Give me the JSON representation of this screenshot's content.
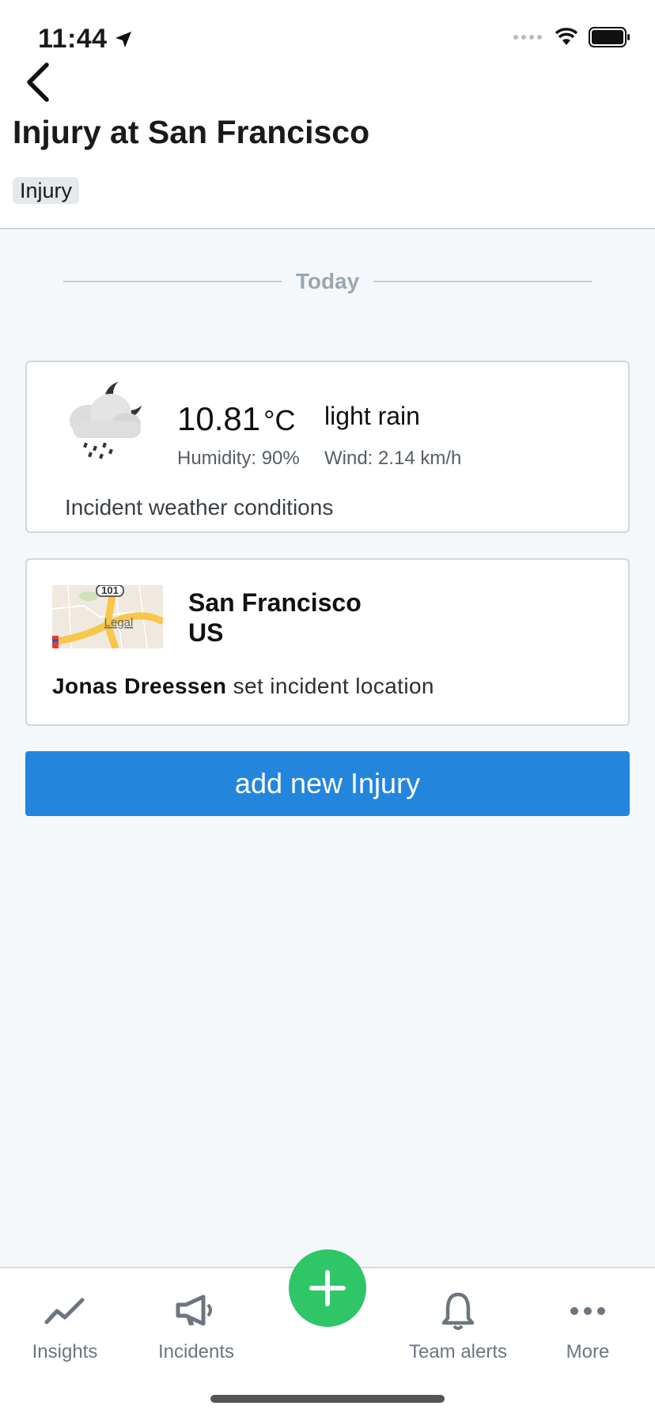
{
  "status_bar": {
    "time": "11:44"
  },
  "header": {
    "title": "Injury at San Francisco",
    "tag": "Injury"
  },
  "timeline": {
    "divider_label": "Today"
  },
  "weather": {
    "temperature": "10.81",
    "unit": "°C",
    "condition": "light rain",
    "humidity": "Humidity: 90%",
    "wind": "Wind: 2.14 km/h",
    "caption": "Incident weather conditions",
    "icon": "rain-cloud-night-icon"
  },
  "location": {
    "city": "San Francisco",
    "country": "US",
    "actor": "Jonas Dreessen",
    "action": "set incident location",
    "map_labels": {
      "route": "101",
      "legal": "Legal"
    }
  },
  "add_button": {
    "label": "add new Injury"
  },
  "tabs": [
    {
      "label": "Insights",
      "icon": "trend-line-icon"
    },
    {
      "label": "Incidents",
      "icon": "megaphone-icon"
    },
    {
      "label": "Team alerts",
      "icon": "bell-icon"
    },
    {
      "label": "More",
      "icon": "more-dots-icon"
    }
  ],
  "fab": {
    "icon": "plus-icon"
  },
  "colors": {
    "accent_blue": "#2386dc",
    "fab_green": "#2fc668",
    "background": "#f5f8fb"
  }
}
